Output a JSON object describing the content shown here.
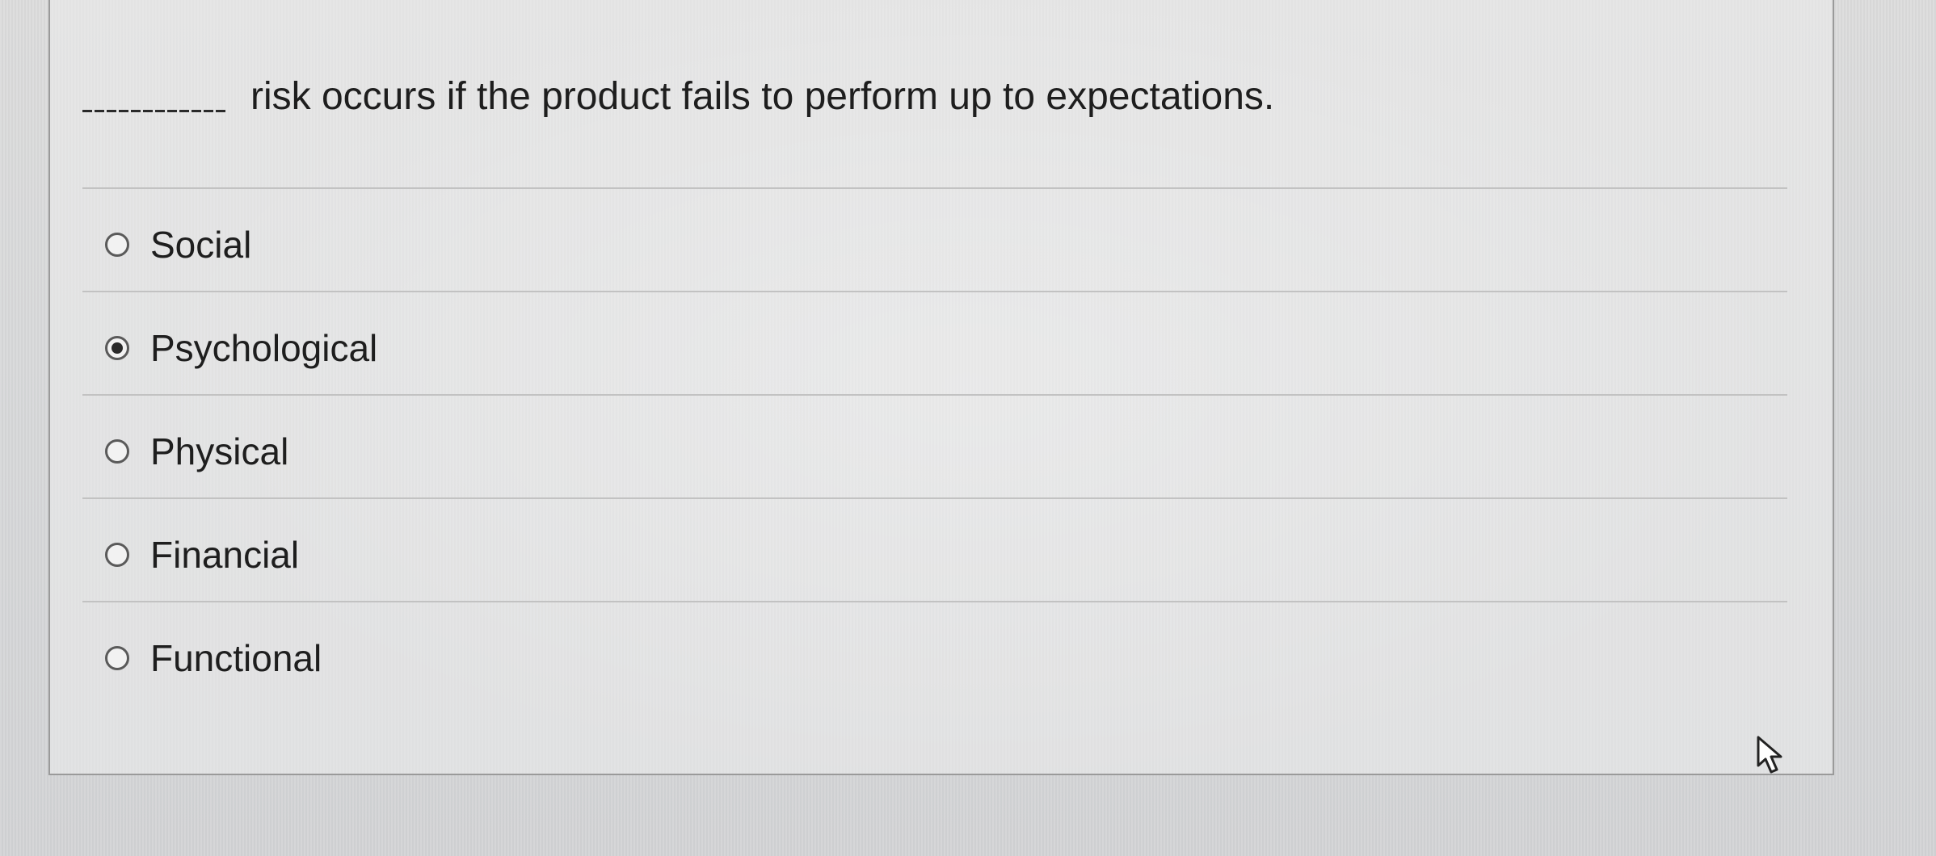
{
  "question": {
    "blank": "________",
    "text": "risk occurs if the product fails to perform up to expectations."
  },
  "options": [
    {
      "label": "Social",
      "selected": false
    },
    {
      "label": "Psychological",
      "selected": true
    },
    {
      "label": "Physical",
      "selected": false
    },
    {
      "label": "Financial",
      "selected": false
    },
    {
      "label": "Functional",
      "selected": false
    }
  ],
  "icons": {
    "cursor": "mouse-pointer-icon"
  }
}
